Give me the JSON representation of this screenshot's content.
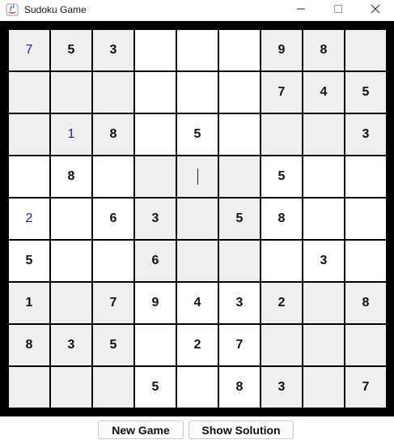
{
  "window": {
    "title": "Sudoku Game",
    "icons": {
      "app": "java-icon",
      "minimize": "minimize-icon",
      "maximize": "maximize-icon",
      "close": "close-icon"
    }
  },
  "board": {
    "rows": [
      [
        "7",
        "5",
        "3",
        "",
        "",
        "",
        "9",
        "8",
        ""
      ],
      [
        "",
        "",
        "",
        "",
        "",
        "",
        "7",
        "4",
        "5"
      ],
      [
        "",
        "1",
        "8",
        "",
        "5",
        "",
        "",
        "",
        "3"
      ],
      [
        "",
        "8",
        "",
        "",
        "",
        "",
        "5",
        "",
        ""
      ],
      [
        "2",
        "",
        "6",
        "3",
        "",
        "5",
        "8",
        "",
        ""
      ],
      [
        "5",
        "",
        "",
        "6",
        "",
        "",
        "",
        "3",
        ""
      ],
      [
        "1",
        "",
        "7",
        "9",
        "4",
        "3",
        "2",
        "",
        "8"
      ],
      [
        "8",
        "3",
        "5",
        "",
        "2",
        "7",
        "",
        "",
        ""
      ],
      [
        "",
        "",
        "",
        "5",
        "",
        "8",
        "3",
        "",
        "7"
      ]
    ],
    "user_entries": [
      [
        0,
        0
      ],
      [
        2,
        1
      ],
      [
        4,
        0
      ]
    ],
    "active_cell": [
      3,
      4
    ],
    "colors": {
      "user_entry": "#1b1bbd",
      "given": "#111111",
      "shaded_box": "#efefef",
      "grid": "#000000"
    }
  },
  "buttons": {
    "new_game": "New Game",
    "show_solution": "Show Solution"
  }
}
